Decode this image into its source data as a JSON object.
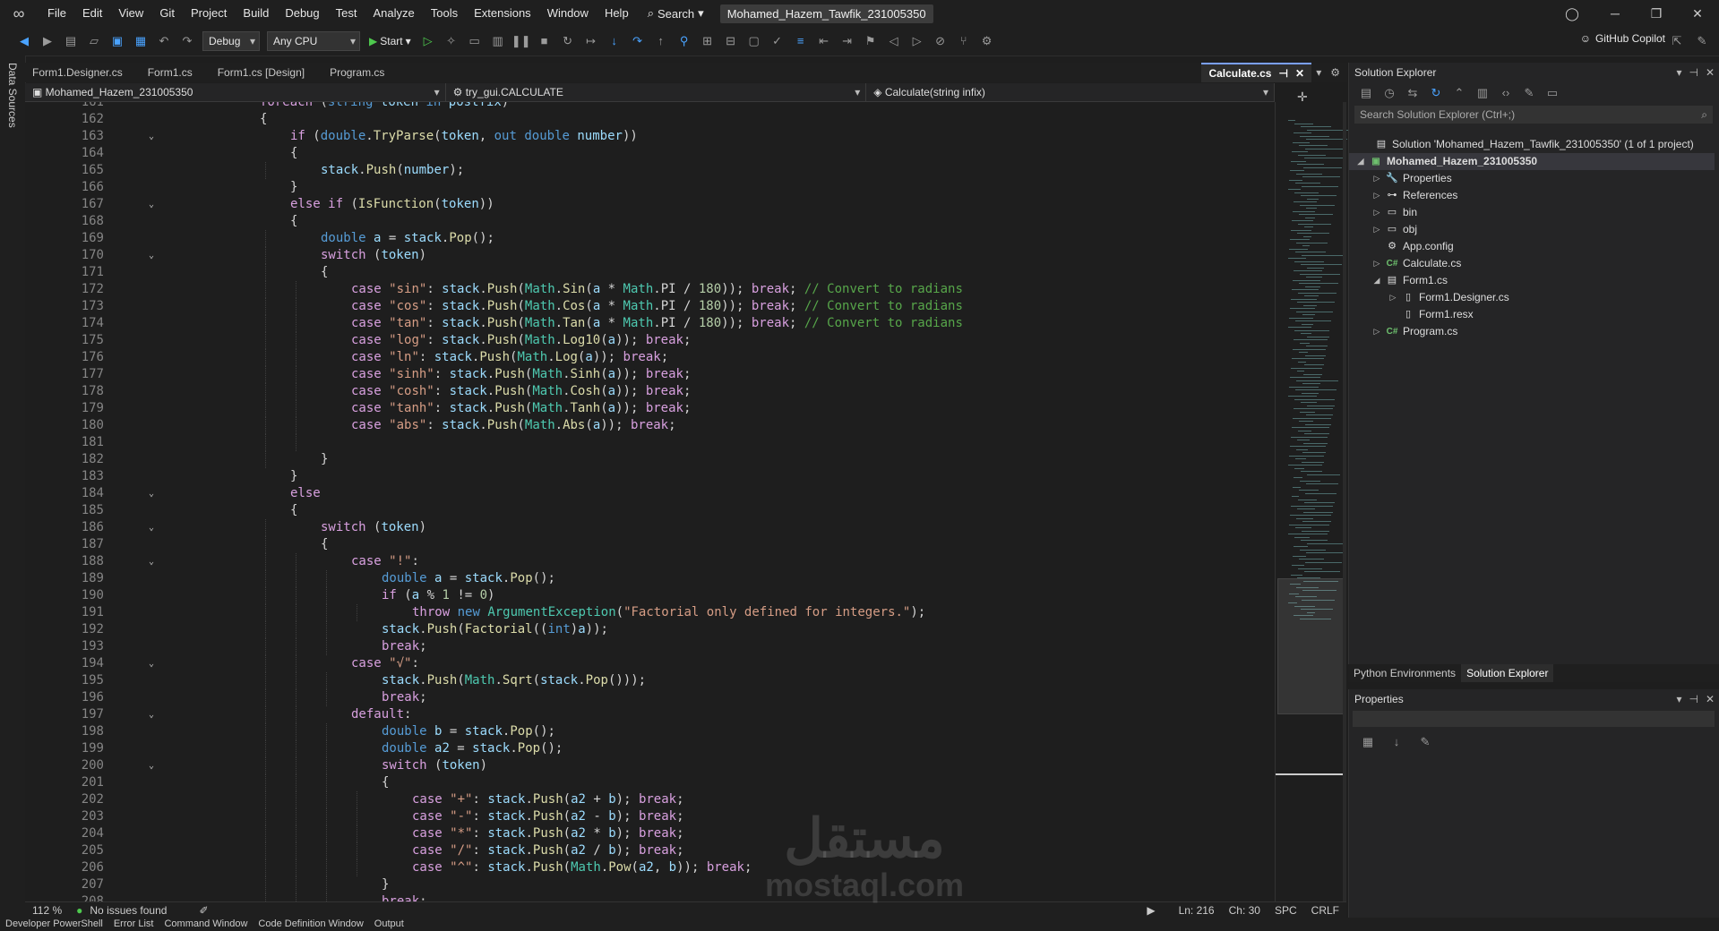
{
  "menu": [
    "File",
    "Edit",
    "View",
    "Git",
    "Project",
    "Build",
    "Debug",
    "Test",
    "Analyze",
    "Tools",
    "Extensions",
    "Window",
    "Help"
  ],
  "search_label": "Search",
  "solution_title": "Mohamed_Hazem_Tawfik_231005350",
  "toolbar": {
    "config": "Debug",
    "platform": "Any CPU",
    "start": "Start",
    "copilot": "GitHub Copilot"
  },
  "left_rail": "Data Sources",
  "tabs": [
    "Form1.Designer.cs",
    "Form1.cs",
    "Form1.cs [Design]",
    "Program.cs"
  ],
  "active_tab": "Calculate.cs",
  "nav": {
    "project": "Mohamed_Hazem_231005350",
    "class": "try_gui.CALCULATE",
    "member": "Calculate(string infix)"
  },
  "code_lines": [
    {
      "n": "161",
      "i": 2,
      "f": "",
      "h": "<span class='cf'>foreach</span> (<span class='k'>string</span> <span class='v'>token</span> <span class='k'>in</span> <span class='v'>postfix</span>)"
    },
    {
      "n": "162",
      "i": 2,
      "f": "",
      "h": "{"
    },
    {
      "n": "163",
      "i": 3,
      "f": "v",
      "h": "<span class='cf'>if</span> (<span class='k'>double</span>.<span class='m'>TryParse</span>(<span class='v'>token</span>, <span class='k'>out</span> <span class='k'>double</span> <span class='v'>number</span>))"
    },
    {
      "n": "164",
      "i": 3,
      "f": "",
      "h": "{"
    },
    {
      "n": "165",
      "i": 4,
      "f": "",
      "h": "<span class='v'>stack</span>.<span class='m'>Push</span>(<span class='v'>number</span>);"
    },
    {
      "n": "166",
      "i": 3,
      "f": "",
      "h": "}"
    },
    {
      "n": "167",
      "i": 3,
      "f": "v",
      "h": "<span class='cf'>else</span> <span class='cf'>if</span> (<span class='m'>IsFunction</span>(<span class='v'>token</span>))"
    },
    {
      "n": "168",
      "i": 3,
      "f": "",
      "h": "{"
    },
    {
      "n": "169",
      "i": 4,
      "f": "",
      "h": "<span class='k'>double</span> <span class='v'>a</span> = <span class='v'>stack</span>.<span class='m'>Pop</span>();"
    },
    {
      "n": "170",
      "i": 4,
      "f": "v",
      "h": "<span class='cf'>switch</span> (<span class='v'>token</span>)"
    },
    {
      "n": "171",
      "i": 4,
      "f": "",
      "h": "{"
    },
    {
      "n": "172",
      "i": 5,
      "f": "",
      "h": "<span class='cf'>case</span> <span class='s'>\"sin\"</span>: <span class='v'>stack</span>.<span class='m'>Push</span>(<span class='t'>Math</span>.<span class='m'>Sin</span>(<span class='v'>a</span> * <span class='t'>Math</span>.PI / <span class='n'>180</span>)); <span class='cf'>break</span>; <span class='c'>// Convert to radians</span>"
    },
    {
      "n": "173",
      "i": 5,
      "f": "",
      "h": "<span class='cf'>case</span> <span class='s'>\"cos\"</span>: <span class='v'>stack</span>.<span class='m'>Push</span>(<span class='t'>Math</span>.<span class='m'>Cos</span>(<span class='v'>a</span> * <span class='t'>Math</span>.PI / <span class='n'>180</span>)); <span class='cf'>break</span>; <span class='c'>// Convert to radians</span>"
    },
    {
      "n": "174",
      "i": 5,
      "f": "",
      "h": "<span class='cf'>case</span> <span class='s'>\"tan\"</span>: <span class='v'>stack</span>.<span class='m'>Push</span>(<span class='t'>Math</span>.<span class='m'>Tan</span>(<span class='v'>a</span> * <span class='t'>Math</span>.PI / <span class='n'>180</span>)); <span class='cf'>break</span>; <span class='c'>// Convert to radians</span>"
    },
    {
      "n": "175",
      "i": 5,
      "f": "",
      "h": "<span class='cf'>case</span> <span class='s'>\"log\"</span>: <span class='v'>stack</span>.<span class='m'>Push</span>(<span class='t'>Math</span>.<span class='m'>Log10</span>(<span class='v'>a</span>)); <span class='cf'>break</span>;"
    },
    {
      "n": "176",
      "i": 5,
      "f": "",
      "h": "<span class='cf'>case</span> <span class='s'>\"ln\"</span>: <span class='v'>stack</span>.<span class='m'>Push</span>(<span class='t'>Math</span>.<span class='m'>Log</span>(<span class='v'>a</span>)); <span class='cf'>break</span>;"
    },
    {
      "n": "177",
      "i": 5,
      "f": "",
      "h": "<span class='cf'>case</span> <span class='s'>\"sinh\"</span>: <span class='v'>stack</span>.<span class='m'>Push</span>(<span class='t'>Math</span>.<span class='m'>Sinh</span>(<span class='v'>a</span>)); <span class='cf'>break</span>;"
    },
    {
      "n": "178",
      "i": 5,
      "f": "",
      "h": "<span class='cf'>case</span> <span class='s'>\"cosh\"</span>: <span class='v'>stack</span>.<span class='m'>Push</span>(<span class='t'>Math</span>.<span class='m'>Cosh</span>(<span class='v'>a</span>)); <span class='cf'>break</span>;"
    },
    {
      "n": "179",
      "i": 5,
      "f": "",
      "h": "<span class='cf'>case</span> <span class='s'>\"tanh\"</span>: <span class='v'>stack</span>.<span class='m'>Push</span>(<span class='t'>Math</span>.<span class='m'>Tanh</span>(<span class='v'>a</span>)); <span class='cf'>break</span>;"
    },
    {
      "n": "180",
      "i": 5,
      "f": "",
      "h": "<span class='cf'>case</span> <span class='s'>\"abs\"</span>: <span class='v'>stack</span>.<span class='m'>Push</span>(<span class='t'>Math</span>.<span class='m'>Abs</span>(<span class='v'>a</span>)); <span class='cf'>break</span>;"
    },
    {
      "n": "181",
      "i": 5,
      "f": "",
      "h": ""
    },
    {
      "n": "182",
      "i": 4,
      "f": "",
      "h": "}"
    },
    {
      "n": "183",
      "i": 3,
      "f": "",
      "h": "}"
    },
    {
      "n": "184",
      "i": 3,
      "f": "v",
      "h": "<span class='cf'>else</span>"
    },
    {
      "n": "185",
      "i": 3,
      "f": "",
      "h": "{"
    },
    {
      "n": "186",
      "i": 4,
      "f": "v",
      "h": "<span class='cf'>switch</span> (<span class='v'>token</span>)"
    },
    {
      "n": "187",
      "i": 4,
      "f": "",
      "h": "{"
    },
    {
      "n": "188",
      "i": 5,
      "f": "v",
      "h": "<span class='cf'>case</span> <span class='s'>\"!\"</span>:"
    },
    {
      "n": "189",
      "i": 6,
      "f": "",
      "h": "<span class='k'>double</span> <span class='v'>a</span> = <span class='v'>stack</span>.<span class='m'>Pop</span>();"
    },
    {
      "n": "190",
      "i": 6,
      "f": "",
      "h": "<span class='cf'>if</span> (<span class='v'>a</span> % <span class='n'>1</span> != <span class='n'>0</span>)"
    },
    {
      "n": "191",
      "i": 7,
      "f": "",
      "h": "<span class='cf'>throw</span> <span class='k'>new</span> <span class='t'>ArgumentException</span>(<span class='s'>\"Factorial only defined for integers.\"</span>);"
    },
    {
      "n": "192",
      "i": 6,
      "f": "",
      "h": "<span class='v'>stack</span>.<span class='m'>Push</span>(<span class='m'>Factorial</span>((<span class='k'>int</span>)<span class='v'>a</span>));"
    },
    {
      "n": "193",
      "i": 6,
      "f": "",
      "h": "<span class='cf'>break</span>;"
    },
    {
      "n": "194",
      "i": 5,
      "f": "v",
      "h": "<span class='cf'>case</span> <span class='s'>\"√\"</span>:"
    },
    {
      "n": "195",
      "i": 6,
      "f": "",
      "h": "<span class='v'>stack</span>.<span class='m'>Push</span>(<span class='t'>Math</span>.<span class='m'>Sqrt</span>(<span class='v'>stack</span>.<span class='m'>Pop</span>()));"
    },
    {
      "n": "196",
      "i": 6,
      "f": "",
      "h": "<span class='cf'>break</span>;"
    },
    {
      "n": "197",
      "i": 5,
      "f": "v",
      "h": "<span class='cf'>default</span>:"
    },
    {
      "n": "198",
      "i": 6,
      "f": "",
      "h": "<span class='k'>double</span> <span class='v'>b</span> = <span class='v'>stack</span>.<span class='m'>Pop</span>();"
    },
    {
      "n": "199",
      "i": 6,
      "f": "",
      "h": "<span class='k'>double</span> <span class='v'>a2</span> = <span class='v'>stack</span>.<span class='m'>Pop</span>();"
    },
    {
      "n": "200",
      "i": 6,
      "f": "v",
      "h": "<span class='cf'>switch</span> (<span class='v'>token</span>)"
    },
    {
      "n": "201",
      "i": 6,
      "f": "",
      "h": "{"
    },
    {
      "n": "202",
      "i": 7,
      "f": "",
      "h": "<span class='cf'>case</span> <span class='s'>\"+\"</span>: <span class='v'>stack</span>.<span class='m'>Push</span>(<span class='v'>a2</span> + <span class='v'>b</span>); <span class='cf'>break</span>;"
    },
    {
      "n": "203",
      "i": 7,
      "f": "",
      "h": "<span class='cf'>case</span> <span class='s'>\"-\"</span>: <span class='v'>stack</span>.<span class='m'>Push</span>(<span class='v'>a2</span> - <span class='v'>b</span>); <span class='cf'>break</span>;"
    },
    {
      "n": "204",
      "i": 7,
      "f": "",
      "h": "<span class='cf'>case</span> <span class='s'>\"*\"</span>: <span class='v'>stack</span>.<span class='m'>Push</span>(<span class='v'>a2</span> * <span class='v'>b</span>); <span class='cf'>break</span>;"
    },
    {
      "n": "205",
      "i": 7,
      "f": "",
      "h": "<span class='cf'>case</span> <span class='s'>\"/\"</span>: <span class='v'>stack</span>.<span class='m'>Push</span>(<span class='v'>a2</span> / <span class='v'>b</span>); <span class='cf'>break</span>;"
    },
    {
      "n": "206",
      "i": 7,
      "f": "",
      "h": "<span class='cf'>case</span> <span class='s'>\"^\"</span>: <span class='v'>stack</span>.<span class='m'>Push</span>(<span class='t'>Math</span>.<span class='m'>Pow</span>(<span class='v'>a2</span>, <span class='v'>b</span>)); <span class='cf'>break</span>;"
    },
    {
      "n": "207",
      "i": 6,
      "f": "",
      "h": "}"
    },
    {
      "n": "208",
      "i": 6,
      "f": "",
      "h": "<span class='cf'>break</span>;"
    }
  ],
  "status": {
    "zoom": "112 %",
    "issues": "No issues found",
    "line": "Ln: 216",
    "col": "Ch: 30",
    "spacing": "SPC",
    "eol": "CRLF"
  },
  "bottom_tabs": [
    "Developer PowerShell",
    "Error List",
    "Command Window",
    "Code Definition Window",
    "Output"
  ],
  "solution_explorer": {
    "title": "Solution Explorer",
    "search_placeholder": "Search Solution Explorer (Ctrl+;)",
    "items": [
      {
        "label": "Solution 'Mohamed_Hazem_Tawfik_231005350' (1 of 1 project)",
        "level": 0,
        "icon": "solution-icon",
        "tri": ""
      },
      {
        "label": "Mohamed_Hazem_231005350",
        "level": 0,
        "icon": "csharp-project-icon",
        "tri": "◢",
        "selected": true
      },
      {
        "label": "Properties",
        "level": 1,
        "icon": "wrench-icon",
        "tri": "▷"
      },
      {
        "label": "References",
        "level": 1,
        "icon": "references-icon",
        "tri": "▷"
      },
      {
        "label": "bin",
        "level": 1,
        "icon": "folder-icon",
        "tri": "▷"
      },
      {
        "label": "obj",
        "level": 1,
        "icon": "folder-icon",
        "tri": "▷"
      },
      {
        "label": "App.config",
        "level": 1,
        "icon": "config-file-icon",
        "tri": ""
      },
      {
        "label": "Calculate.cs",
        "level": 1,
        "icon": "csharp-file-icon",
        "tri": "▷"
      },
      {
        "label": "Form1.cs",
        "level": 1,
        "icon": "form-icon",
        "tri": "◢"
      },
      {
        "label": "Form1.Designer.cs",
        "level": 2,
        "icon": "file-icon",
        "tri": "▷"
      },
      {
        "label": "Form1.resx",
        "level": 2,
        "icon": "file-icon",
        "tri": ""
      },
      {
        "label": "Program.cs",
        "level": 1,
        "icon": "csharp-file-icon",
        "tri": "▷"
      }
    ]
  },
  "pane_tabs": [
    "Python Environments",
    "Solution Explorer"
  ],
  "properties_title": "Properties",
  "watermark": {
    "ar": "مستقل",
    "en": "mostaql.com"
  }
}
